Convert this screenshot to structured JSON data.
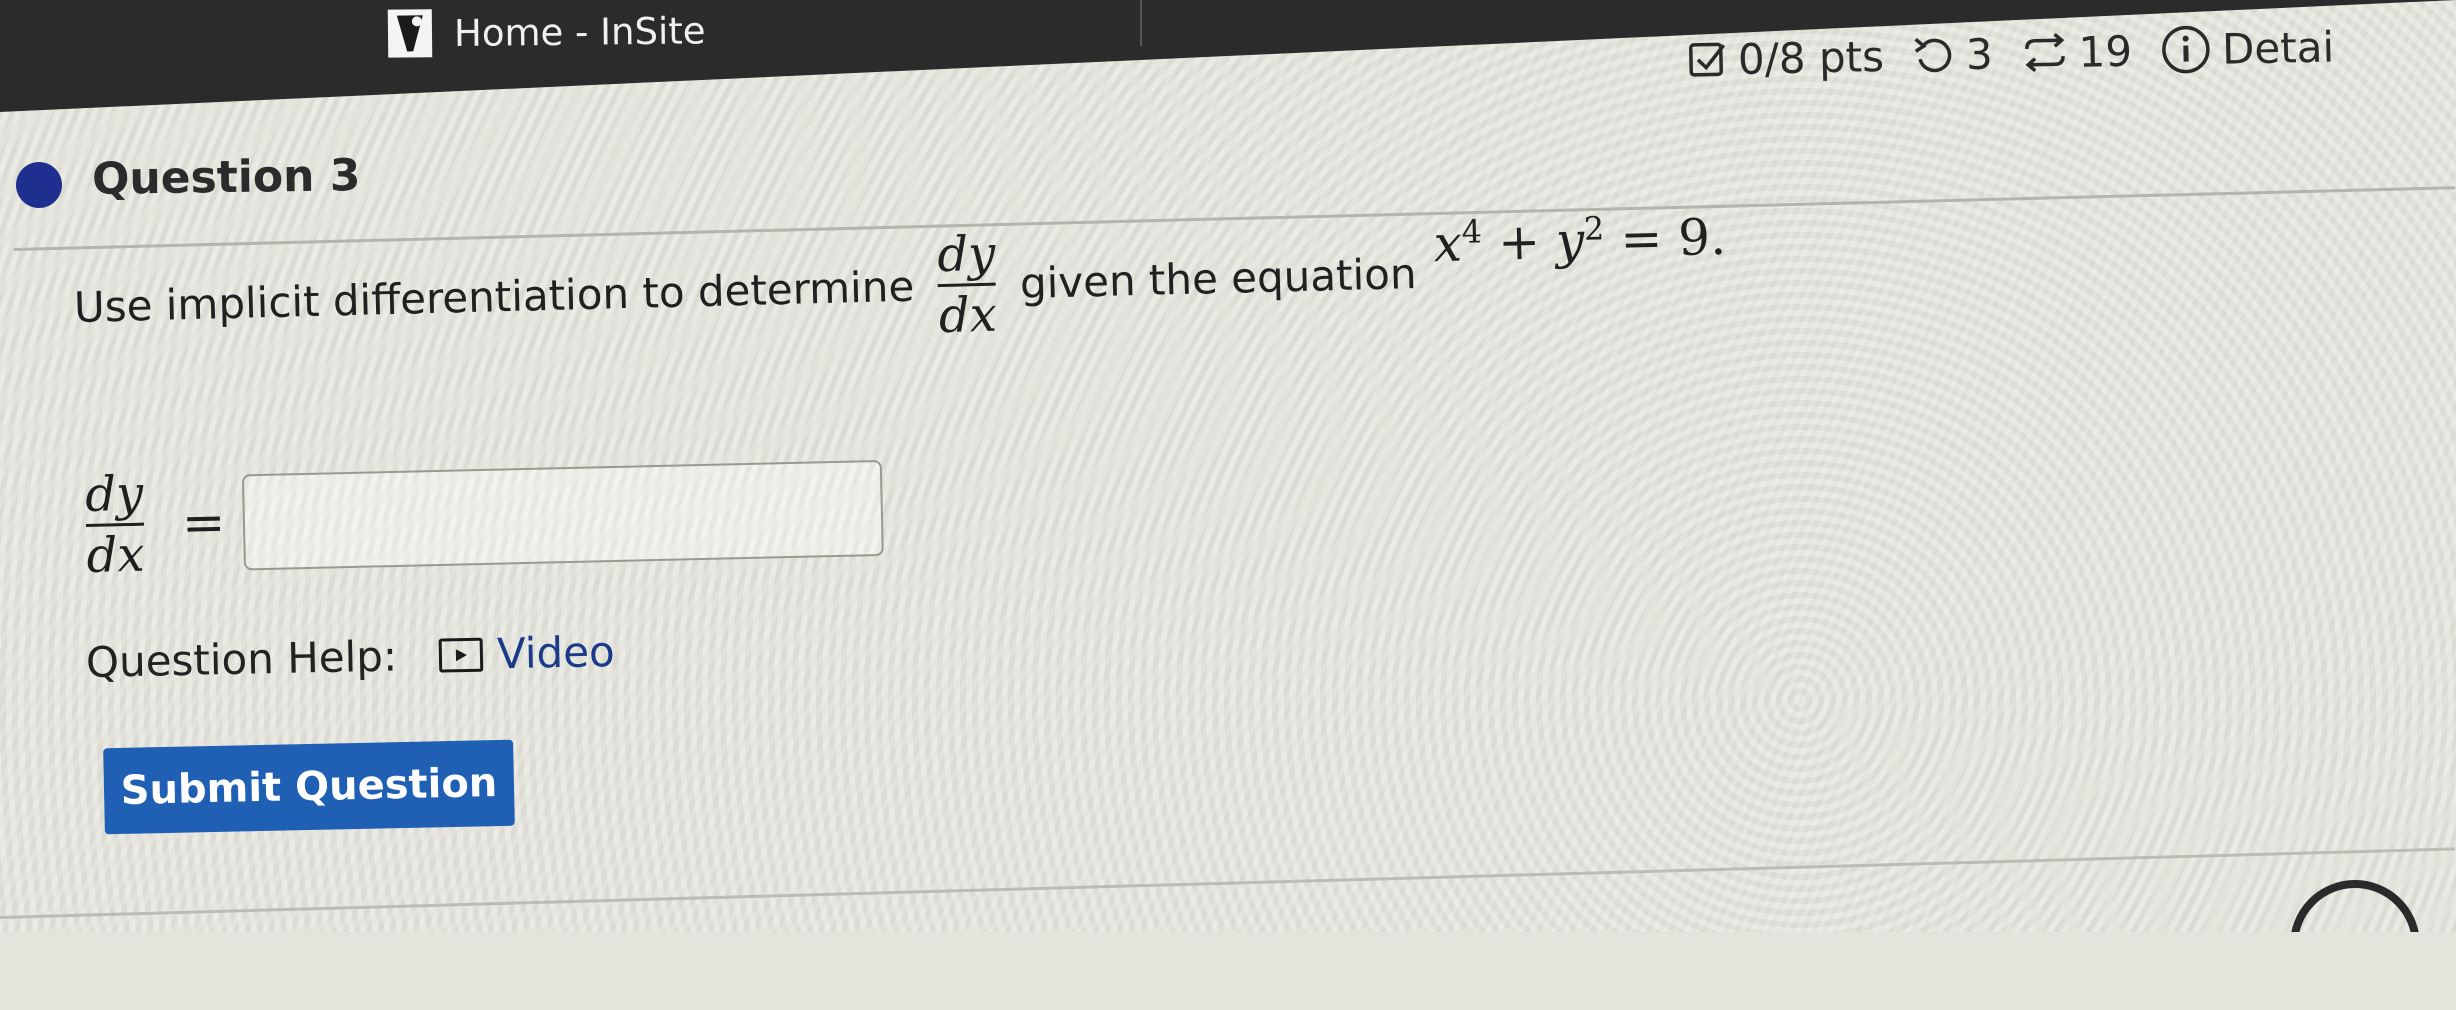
{
  "browser": {
    "tab_title": "Home - InSite"
  },
  "stats": {
    "points": "0/8 pts",
    "retries": "3",
    "attempts": "19",
    "details_label": "Detai"
  },
  "question": {
    "title": "Question 3",
    "prompt_text": "Use implicit differentiation to determine",
    "frac_num": "dy",
    "frac_den": "dx",
    "prompt_text_2": "given the equation",
    "eq_var_x": "x",
    "eq_exp_x": "4",
    "eq_plus": "+",
    "eq_var_y": "y",
    "eq_exp_y": "2",
    "eq_rhs": "= 9."
  },
  "answer": {
    "lhs_num": "dy",
    "lhs_den": "dx",
    "equals": "=",
    "value": ""
  },
  "help": {
    "label": "Question Help:",
    "video_label": "Video"
  },
  "submit": {
    "label": "Submit Question"
  },
  "colors": {
    "accent": "#1f5fb4",
    "dot": "#1f2f8f"
  }
}
